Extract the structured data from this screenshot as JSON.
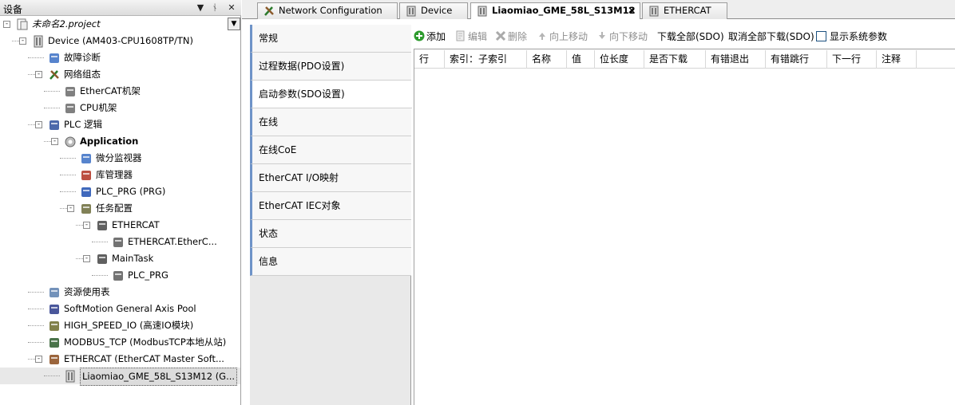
{
  "left_panel": {
    "title": "设备",
    "controls": {
      "dropdown": "▼",
      "pin": "ᚾ",
      "close": "✕"
    },
    "tree": [
      {
        "label": "未命名2.project",
        "icon": "project-icon",
        "toggle": "-"
      },
      {
        "label": "Device (AM403-CPU1608TP/TN)",
        "icon": "device-icon",
        "toggle": "-"
      },
      {
        "label": "故障诊断",
        "icon": "diagnosis-icon",
        "toggle": ""
      },
      {
        "label": "网络组态",
        "icon": "network-config-icon",
        "toggle": "-"
      },
      {
        "label": "EtherCAT机架",
        "icon": "rack-icon",
        "toggle": ""
      },
      {
        "label": "CPU机架",
        "icon": "rack-icon",
        "toggle": ""
      },
      {
        "label": "PLC 逻辑",
        "icon": "plc-logic-icon",
        "toggle": "-"
      },
      {
        "label": "Application",
        "icon": "application-icon",
        "toggle": "-"
      },
      {
        "label": "微分监视器",
        "icon": "monitor-icon",
        "toggle": ""
      },
      {
        "label": "库管理器",
        "icon": "library-icon",
        "toggle": ""
      },
      {
        "label": "PLC_PRG (PRG)",
        "icon": "program-icon",
        "toggle": ""
      },
      {
        "label": "任务配置",
        "icon": "task-config-icon",
        "toggle": "-"
      },
      {
        "label": "ETHERCAT",
        "icon": "task-icon",
        "toggle": "-"
      },
      {
        "label": "ETHERCAT.EtherC...",
        "icon": "call-icon",
        "toggle": ""
      },
      {
        "label": "MainTask",
        "icon": "task-icon",
        "toggle": "-"
      },
      {
        "label": "PLC_PRG",
        "icon": "call-icon",
        "toggle": ""
      },
      {
        "label": "资源使用表",
        "icon": "table-icon",
        "toggle": ""
      },
      {
        "label": "SoftMotion General Axis Pool",
        "icon": "axis-pool-icon",
        "toggle": ""
      },
      {
        "label": "HIGH_SPEED_IO (高速IO模块)",
        "icon": "io-module-icon",
        "toggle": ""
      },
      {
        "label": "MODBUS_TCP (ModbusTCP本地从站)",
        "icon": "modbus-icon",
        "toggle": ""
      },
      {
        "label": "ETHERCAT (EtherCAT Master Soft...",
        "icon": "ethercat-master-icon",
        "toggle": "-"
      },
      {
        "label": "Liaomiao_GME_58L_S13M12 (G...",
        "icon": "slave-device-icon",
        "toggle": ""
      }
    ]
  },
  "tabs": [
    {
      "label": "Network Configuration",
      "icon": "network-config-icon"
    },
    {
      "label": "Device",
      "icon": "device-icon"
    },
    {
      "label": "Liaomiao_GME_58L_S13M12",
      "icon": "slave-device-icon",
      "active": true,
      "close": "✕"
    },
    {
      "label": "ETHERCAT",
      "icon": "device-icon"
    }
  ],
  "side_tabs": [
    {
      "label": "常规"
    },
    {
      "label": "过程数据(PDO设置)"
    },
    {
      "label": "启动参数(SDO设置)",
      "active": true
    },
    {
      "label": "在线"
    },
    {
      "label": "在线CoE"
    },
    {
      "label": "EtherCAT I/O映射"
    },
    {
      "label": "EtherCAT IEC对象"
    },
    {
      "label": "状态"
    },
    {
      "label": "信息"
    }
  ],
  "toolbar": {
    "add": "添加",
    "edit": "编辑",
    "delete": "删除",
    "move_up": "向上移动",
    "move_down": "向下移动",
    "download_all": "下载全部(SDO)",
    "cancel_download_all": "取消全部下载(SDO)",
    "show_system_params": "显示系统参数",
    "show_system_params_checked": false
  },
  "grid": {
    "columns": [
      "行",
      "索引：子索引",
      "名称",
      "值",
      "位长度",
      "是否下载",
      "有错退出",
      "有错跳行",
      "下一行",
      "注释"
    ]
  }
}
